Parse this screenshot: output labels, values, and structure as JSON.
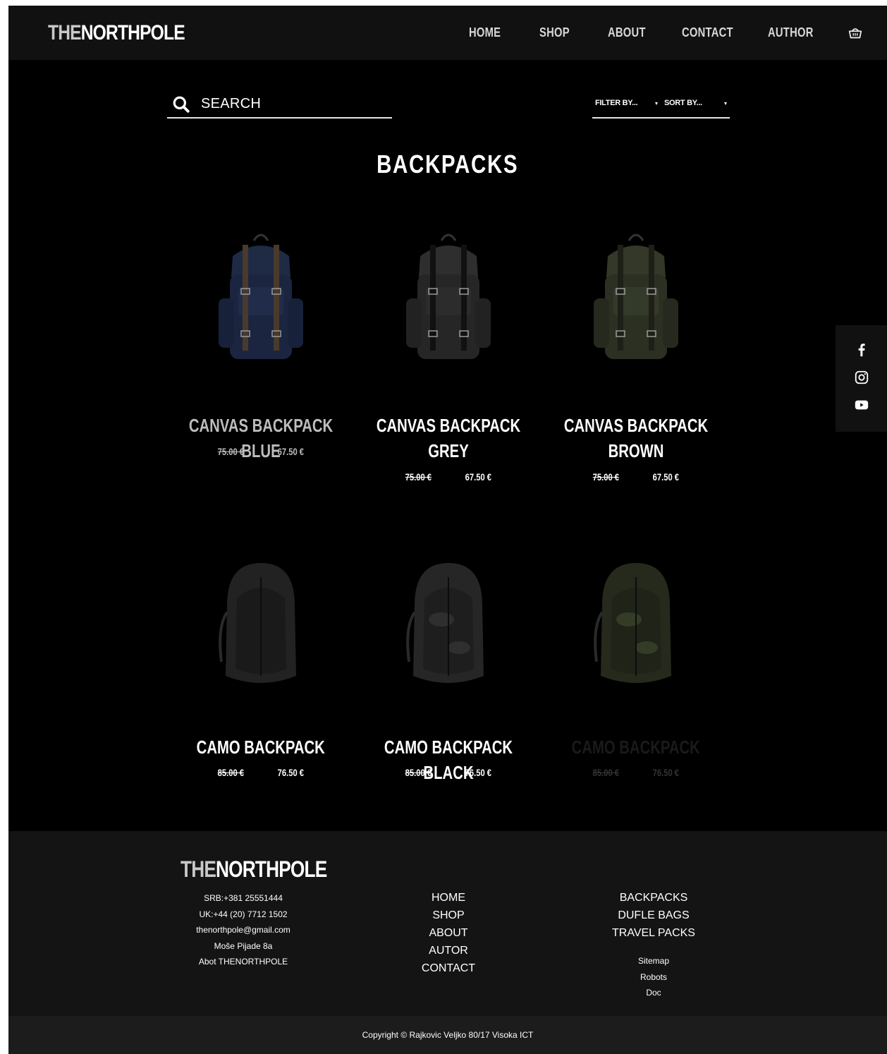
{
  "header": {
    "logo_the": "THE",
    "logo_rest": "NORTHPOLE",
    "nav": [
      "HOME",
      "SHOP",
      "ABOUT",
      "CONTACT",
      "AUTHOR"
    ]
  },
  "toolbar": {
    "search_label": "SEARCH",
    "filter_label": "FILTER BY...",
    "sort_label": "SORT BY..."
  },
  "page_title": "BACKPACKS",
  "products": [
    {
      "name": "CANVAS BACKPACK BLUE",
      "old_price": "75.00 €",
      "price": "67.50 €",
      "color": "#1f2a44"
    },
    {
      "name": "CANVAS BACKPACK GREY",
      "old_price": "75.00 €",
      "price": "67.50 €",
      "color": "#2b2b2b"
    },
    {
      "name": "CANVAS BACKPACK BROWN",
      "old_price": "75.00 €",
      "price": "67.50 €",
      "color": "#2f3326"
    },
    {
      "name": "CAMO BACKPACK",
      "old_price": "85.00 €",
      "price": "76.50 €",
      "color": "#222222"
    },
    {
      "name": "CAMO BACKPACK BLACK",
      "old_price": "85.00 €",
      "price": "76.50 €",
      "color": "#262626"
    },
    {
      "name": "CAMO BACKPACK",
      "old_price": "85.00 €",
      "price": "76.50 €",
      "color": "#29301f"
    }
  ],
  "footer": {
    "logo_the": "THE",
    "logo_rest": "NORTHPOLE",
    "contact": [
      "SRB:+381 25551444",
      "UK:+44 (20) 7712 1502",
      "thenorthpole@gmail.com",
      "Moše Pijade 8a",
      "Abot THENORTHPOLE"
    ],
    "nav": [
      "HOME",
      "SHOP",
      "ABOUT",
      "AUTOR",
      "CONTACT"
    ],
    "categories": [
      "BACKPACKS",
      "DUFLE BAGS",
      "TRAVEL PACKS"
    ],
    "misc": [
      "Sitemap",
      "Robots",
      "Doc"
    ],
    "copyright": "Copyright © Rajkovic Veljko 80/17 Visoka ICT"
  },
  "colors": {
    "background": "#000000",
    "header": "#111111",
    "footer": "#141414",
    "text": "#ffffff"
  }
}
